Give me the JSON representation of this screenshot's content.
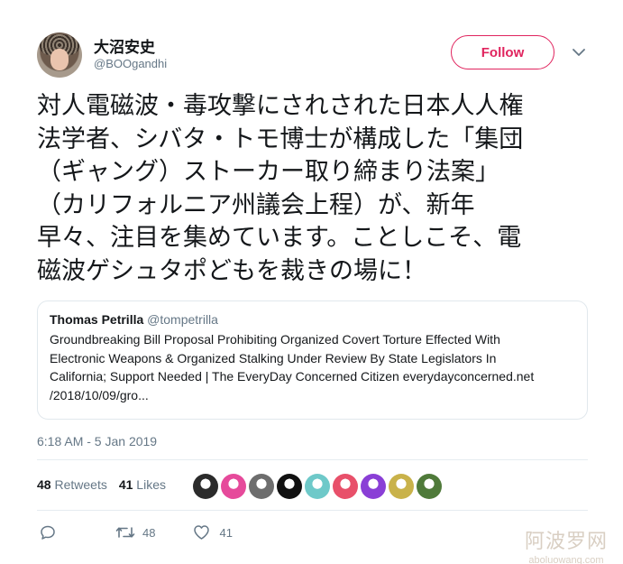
{
  "author": {
    "display_name": "大沼安史",
    "handle": "@BOOgandhi",
    "follow_label": "Follow",
    "accent": "#e0245e"
  },
  "tweet": {
    "lines": [
      "対人電磁波・毒攻撃にされされた日本人人権",
      "法学者、シバタ・トモ博士が構成した「集団",
      "（ギャング）ストーカー取り締まり法案」",
      "（カリフォルニア州議会上程）が、新年",
      "早々、注目を集めています。ことしこそ、電",
      "磁波ゲシュタポどもを裁きの場に！"
    ]
  },
  "quoted_tweet": {
    "name": "Thomas Petrilla",
    "handle": "@tompetrilla",
    "lines": [
      "Groundbreaking Bill Proposal Prohibiting Organized Covert Torture Effected With",
      "Electronic Weapons & Organized Stalking Under Review By State Legislators In",
      "California; Support Needed | The EveryDay Concerned Citizen everydayconcerned.net",
      "/2018/10/09/gro..."
    ]
  },
  "timestamp": "6:18 AM - 5 Jan 2019",
  "stats": {
    "retweets_count": "48",
    "retweets_label": "Retweets",
    "likes_count": "41",
    "likes_label": "Likes"
  },
  "liker_avatars": [
    {
      "icon": "liker-avatar-1",
      "color": "#2b2b2b"
    },
    {
      "icon": "liker-avatar-2",
      "color": "#e64a9b"
    },
    {
      "icon": "liker-avatar-3",
      "color": "#6d6d6d"
    },
    {
      "icon": "liker-avatar-4",
      "color": "#111111"
    },
    {
      "icon": "liker-avatar-5",
      "color": "#6ec9c9"
    },
    {
      "icon": "liker-avatar-6",
      "color": "#e8506a"
    },
    {
      "icon": "liker-avatar-7",
      "color": "#8a3fd6"
    },
    {
      "icon": "liker-avatar-8",
      "color": "#c9b24a"
    },
    {
      "icon": "liker-avatar-9",
      "color": "#4f7a3a"
    }
  ],
  "actions": {
    "reply_icon": "reply-icon",
    "retweet_count": "48",
    "like_count": "41"
  },
  "watermark": {
    "chinese": "阿波罗网",
    "url": "aboluowang.com"
  }
}
